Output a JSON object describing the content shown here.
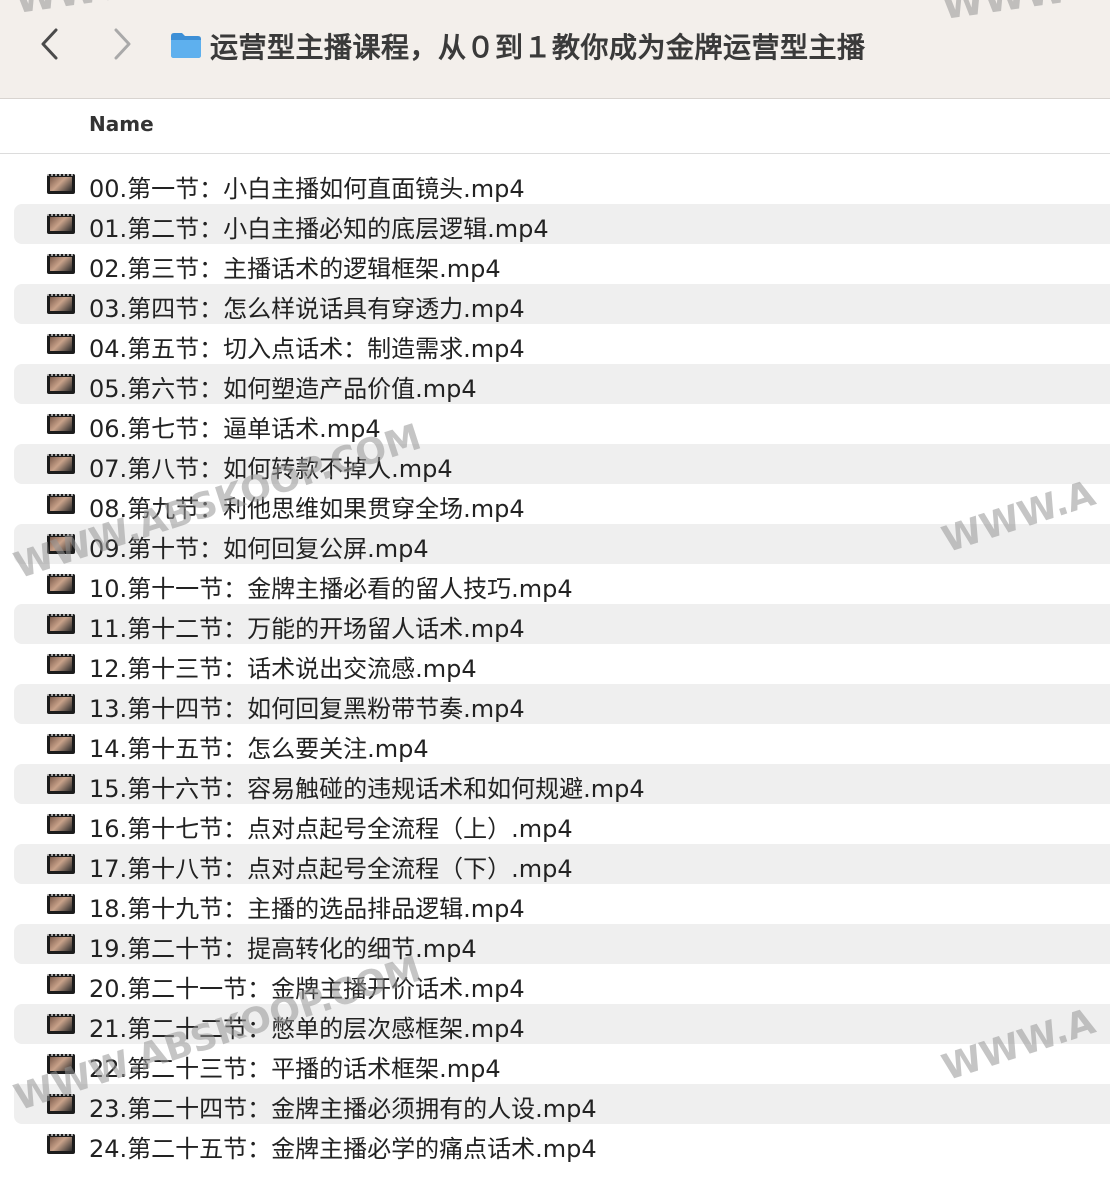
{
  "window": {
    "title": "运营型主播课程，从０到１教你成为金牌运营型主播"
  },
  "toolbar": {
    "back_icon": "chevron-left-icon",
    "forward_icon": "chevron-right-icon",
    "folder_icon": "folder-icon",
    "folder_color": "#4aa3e8"
  },
  "list_header": {
    "name": "Name"
  },
  "files": [
    "00.第一节：小白主播如何直面镜头.mp4",
    "01.第二节：小白主播必知的底层逻辑.mp4",
    "02.第三节：主播话术的逻辑框架.mp4",
    "03.第四节：怎么样说话具有穿透力.mp4",
    "04.第五节：切入点话术：制造需求.mp4",
    "05.第六节：如何塑造产品价值.mp4",
    "06.第七节：逼单话术.mp4",
    "07.第八节：如何转款不掉人.mp4",
    "08.第九节：利他思维如果贯穿全场.mp4",
    "09.第十节：如何回复公屏.mp4",
    "10.第十一节：金牌主播必看的留人技巧.mp4",
    "11.第十二节：万能的开场留人话术.mp4",
    "12.第十三节：话术说出交流感.mp4",
    "13.第十四节：如何回复黑粉带节奏.mp4",
    "14.第十五节：怎么要关注.mp4",
    "15.第十六节：容易触碰的违规话术和如何规避.mp4",
    "16.第十七节：点对点起号全流程（上）.mp4",
    "17.第十八节：点对点起号全流程（下）.mp4",
    "18.第十九节：主播的选品排品逻辑.mp4",
    "19.第二十节：提高转化的细节.mp4",
    "20.第二十一节：金牌主播开价话术.mp4",
    "21.第二十二节：憋单的层次感框架.mp4",
    "22.第二十三节：平播的话术框架.mp4",
    "23.第二十四节：金牌主播必须拥有的人设.mp4",
    "24.第二十五节：金牌主播必学的痛点话术.mp4"
  ],
  "file_icon": "video-thumbnail-icon",
  "watermark": {
    "text": "WWW.ABSKOOP.COM",
    "partial": "WWW.A"
  }
}
